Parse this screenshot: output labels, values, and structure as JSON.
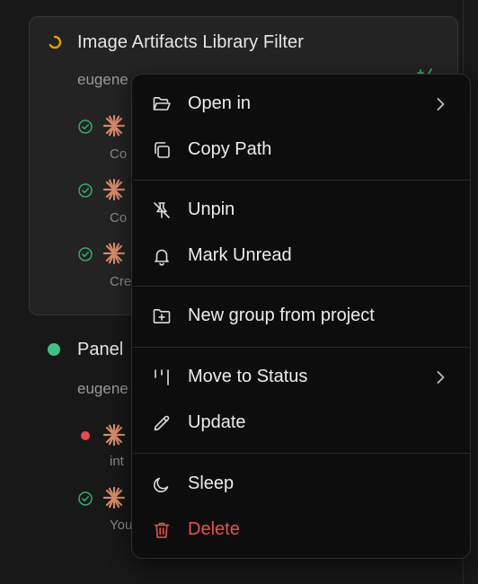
{
  "card": {
    "title": "Image Artifacts Library Filter",
    "subtitle": "eugene",
    "rows": [
      {
        "status": "done",
        "text": "Co"
      },
      {
        "status": "done",
        "text": "Co"
      },
      {
        "status": "done",
        "text": "Cre"
      }
    ]
  },
  "task2": {
    "title": "Panel",
    "subtitle": "eugene",
    "rows": [
      {
        "status": "error",
        "text": "int"
      },
      {
        "status": "done",
        "text": "You"
      }
    ]
  },
  "menu": {
    "open_in": "Open in",
    "copy_path": "Copy Path",
    "unpin": "Unpin",
    "mark_unread": "Mark Unread",
    "new_group": "New group from project",
    "move_to_status": "Move to Status",
    "update": "Update",
    "sleep": "Sleep",
    "delete": "Delete"
  },
  "colors": {
    "accent_orange": "#e0a000",
    "done_green": "#3aa86b",
    "active_green": "#3fc285",
    "error_red": "#e5484d",
    "asterisk": "#d98a6a",
    "danger": "#e5534b"
  }
}
